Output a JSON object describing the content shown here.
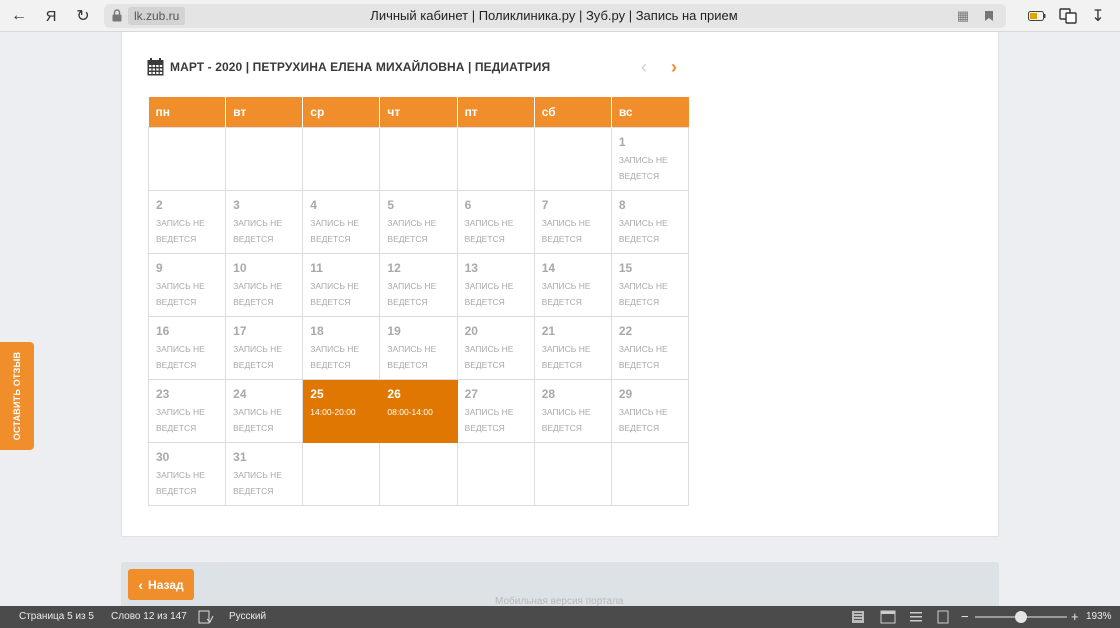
{
  "browser": {
    "domain": "lk.zub.ru",
    "page_title": "Личный кабинет | Поликлиника.ру | Зуб.ру | Запись на прием",
    "yandex_button": "Я"
  },
  "calendar": {
    "title": "МАРТ - 2020 | ПЕТРУХИНА ЕЛЕНА МИХАЙЛОВНА | ПЕДИАТРИЯ",
    "weekdays": [
      "пн",
      "вт",
      "ср",
      "чт",
      "пт",
      "сб",
      "вс"
    ],
    "weeks": [
      [
        null,
        null,
        null,
        null,
        null,
        null,
        {
          "day": "1",
          "note": "ЗАПИСЬ НЕ ВЕДЕТСЯ"
        }
      ],
      [
        {
          "day": "2",
          "note": "ЗАПИСЬ НЕ ВЕДЕТСЯ"
        },
        {
          "day": "3",
          "note": "ЗАПИСЬ НЕ ВЕДЕТСЯ"
        },
        {
          "day": "4",
          "note": "ЗАПИСЬ НЕ ВЕДЕТСЯ"
        },
        {
          "day": "5",
          "note": "ЗАПИСЬ НЕ ВЕДЕТСЯ"
        },
        {
          "day": "6",
          "note": "ЗАПИСЬ НЕ ВЕДЕТСЯ"
        },
        {
          "day": "7",
          "note": "ЗАПИСЬ НЕ ВЕДЕТСЯ"
        },
        {
          "day": "8",
          "note": "ЗАПИСЬ НЕ ВЕДЕТСЯ"
        }
      ],
      [
        {
          "day": "9",
          "note": "ЗАПИСЬ НЕ ВЕДЕТСЯ"
        },
        {
          "day": "10",
          "note": "ЗАПИСЬ НЕ ВЕДЕТСЯ"
        },
        {
          "day": "11",
          "note": "ЗАПИСЬ НЕ ВЕДЕТСЯ"
        },
        {
          "day": "12",
          "note": "ЗАПИСЬ НЕ ВЕДЕТСЯ"
        },
        {
          "day": "13",
          "note": "ЗАПИСЬ НЕ ВЕДЕТСЯ"
        },
        {
          "day": "14",
          "note": "ЗАПИСЬ НЕ ВЕДЕТСЯ"
        },
        {
          "day": "15",
          "note": "ЗАПИСЬ НЕ ВЕДЕТСЯ"
        }
      ],
      [
        {
          "day": "16",
          "note": "ЗАПИСЬ НЕ ВЕДЕТСЯ"
        },
        {
          "day": "17",
          "note": "ЗАПИСЬ НЕ ВЕДЕТСЯ"
        },
        {
          "day": "18",
          "note": "ЗАПИСЬ НЕ ВЕДЕТСЯ"
        },
        {
          "day": "19",
          "note": "ЗАПИСЬ НЕ ВЕДЕТСЯ"
        },
        {
          "day": "20",
          "note": "ЗАПИСЬ НЕ ВЕДЕТСЯ"
        },
        {
          "day": "21",
          "note": "ЗАПИСЬ НЕ ВЕДЕТСЯ"
        },
        {
          "day": "22",
          "note": "ЗАПИСЬ НЕ ВЕДЕТСЯ"
        }
      ],
      [
        {
          "day": "23",
          "note": "ЗАПИСЬ НЕ ВЕДЕТСЯ"
        },
        {
          "day": "24",
          "note": "ЗАПИСЬ НЕ ВЕДЕТСЯ"
        },
        {
          "day": "25",
          "note": "14:00-20:00",
          "available": true
        },
        {
          "day": "26",
          "note": "08:00-14:00",
          "available": true
        },
        {
          "day": "27",
          "note": "ЗАПИСЬ НЕ ВЕДЕТСЯ"
        },
        {
          "day": "28",
          "note": "ЗАПИСЬ НЕ ВЕДЕТСЯ"
        },
        {
          "day": "29",
          "note": "ЗАПИСЬ НЕ ВЕДЕТСЯ"
        }
      ],
      [
        {
          "day": "30",
          "note": "ЗАПИСЬ НЕ ВЕДЕТСЯ"
        },
        {
          "day": "31",
          "note": "ЗАПИСЬ НЕ ВЕДЕТСЯ"
        },
        null,
        null,
        null,
        null,
        null
      ]
    ]
  },
  "feedback_tab": "ОСТАВИТЬ ОТЗЫВ",
  "back_button": "Назад",
  "mobile_link": "Мобильная версия портала",
  "statusbar": {
    "page": "Страница 5 из 5",
    "words": "Слово 12 из 147",
    "language": "Русский",
    "zoom": "193%"
  },
  "colors": {
    "accent": "#ef8e2b",
    "active_day": "#df7700"
  }
}
